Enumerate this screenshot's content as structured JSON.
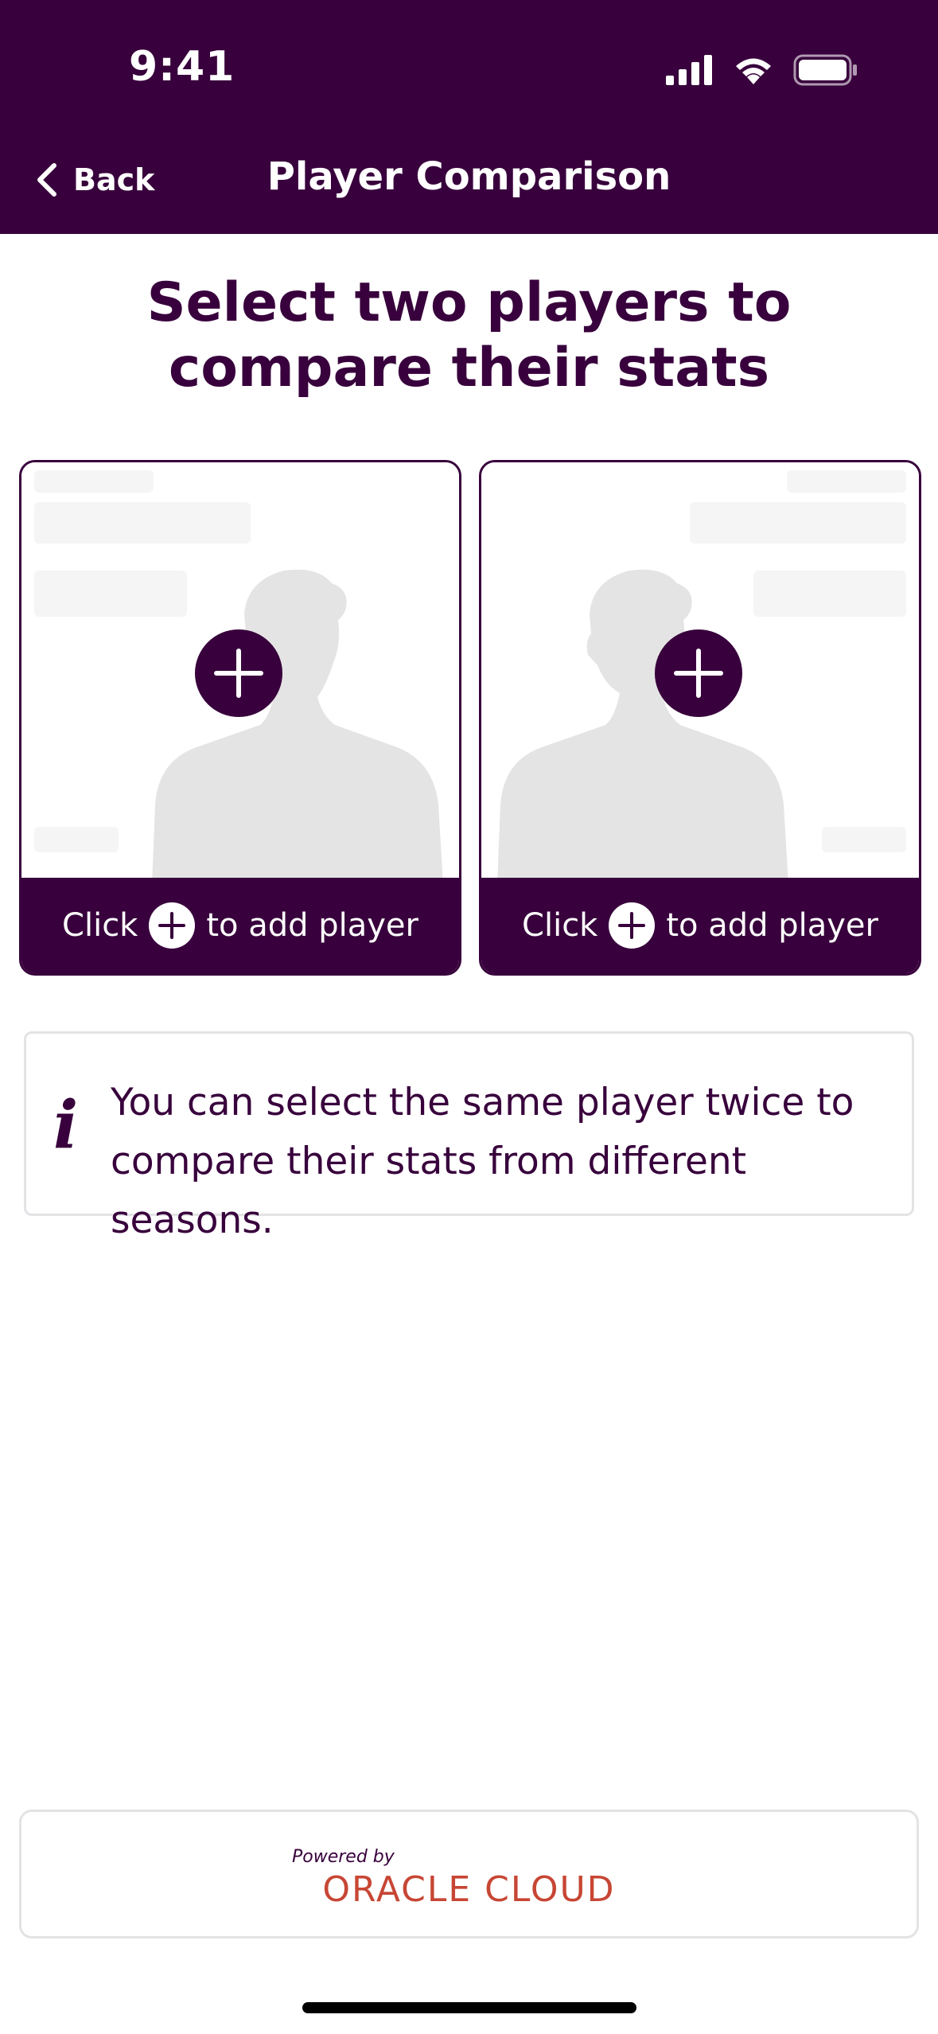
{
  "status_bar": {
    "time": "9:41"
  },
  "nav": {
    "back_label": "Back",
    "title": "Player Comparison"
  },
  "prompt": {
    "line1": "Select two players to",
    "line2": "compare their stats"
  },
  "slots": [
    {
      "click_label": "Click",
      "action_label": "to add player"
    },
    {
      "click_label": "Click",
      "action_label": "to add player"
    }
  ],
  "info": {
    "icon": "info-icon",
    "text": "You can select the same player twice to compare their stats from different seasons."
  },
  "sponsor": {
    "powered_by": "Powered by",
    "brand": "ORACLE CLOUD"
  },
  "colors": {
    "primary": "#38003c",
    "brand_red": "#c74634",
    "border": "#e3e3e6"
  }
}
